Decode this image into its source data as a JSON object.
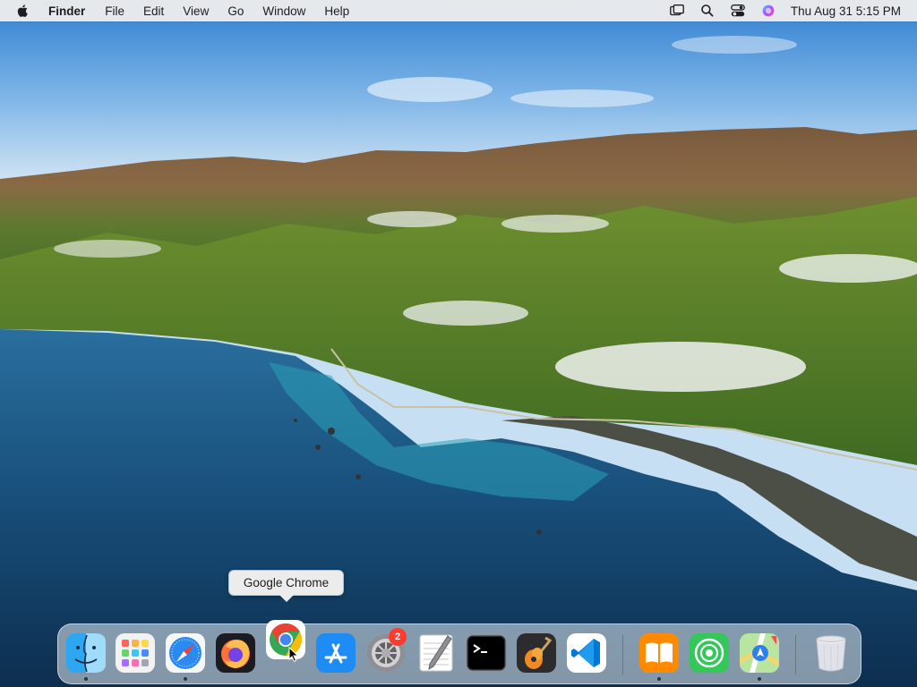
{
  "menubar": {
    "app_name": "Finder",
    "menus": [
      "File",
      "Edit",
      "View",
      "Go",
      "Window",
      "Help"
    ],
    "clock": "Thu Aug 31  5:15 PM",
    "status_icons": [
      "screen-mirroring-icon",
      "search-icon",
      "control-center-icon",
      "siri-icon"
    ]
  },
  "tooltip": {
    "text": "Google Chrome"
  },
  "dock": {
    "items": [
      {
        "name": "finder",
        "icon": "finder-icon",
        "running": true
      },
      {
        "name": "launchpad",
        "icon": "launchpad-icon",
        "running": false
      },
      {
        "name": "safari",
        "icon": "safari-icon",
        "running": true
      },
      {
        "name": "firefox",
        "icon": "firefox-icon",
        "running": false
      },
      {
        "name": "google-chrome",
        "icon": "chrome-icon",
        "running": false,
        "hovered": true
      },
      {
        "name": "app-store",
        "icon": "app-store-icon",
        "running": false
      },
      {
        "name": "system-preferences",
        "icon": "system-preferences-icon",
        "running": false,
        "badge": "2"
      },
      {
        "name": "textedit",
        "icon": "textedit-icon",
        "running": false
      },
      {
        "name": "terminal",
        "icon": "terminal-icon",
        "running": false
      },
      {
        "name": "garageband",
        "icon": "garageband-icon",
        "running": false
      },
      {
        "name": "vscode",
        "icon": "vscode-icon",
        "running": false
      },
      {
        "name": "books",
        "icon": "books-icon",
        "running": true
      },
      {
        "name": "find-my",
        "icon": "find-my-icon",
        "running": false
      },
      {
        "name": "maps",
        "icon": "maps-icon",
        "running": true
      },
      {
        "name": "trash",
        "icon": "trash-icon",
        "running": false
      }
    ]
  },
  "colors": {
    "menubar_bg": "#ececec",
    "badge": "#ff3b30",
    "chrome_red": "#ea4335",
    "chrome_yellow": "#fbbc05",
    "chrome_green": "#34a853",
    "chrome_blue": "#4285f4"
  }
}
